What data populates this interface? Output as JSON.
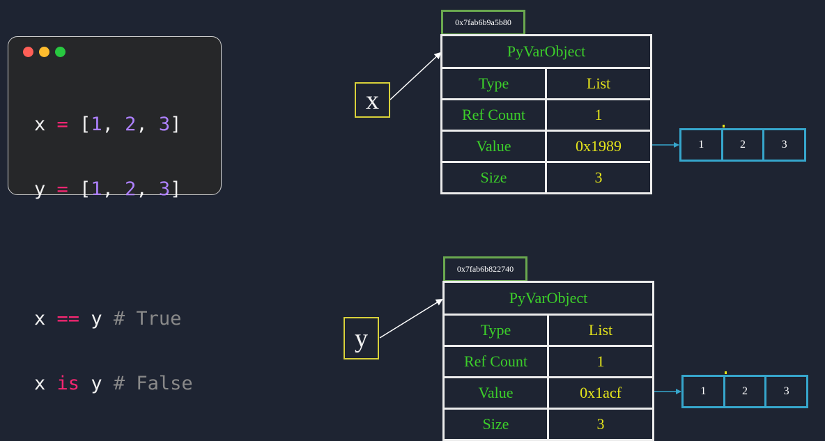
{
  "code_window": {
    "dot_colors": [
      "#ff5f57",
      "#febc2e",
      "#28c840"
    ],
    "lines": [
      {
        "var": "x",
        "op": "=",
        "open": "[",
        "n1": "1",
        "c1": ", ",
        "n2": "2",
        "c2": ", ",
        "n3": "3",
        "close": "]"
      },
      {
        "var": "y",
        "op": "=",
        "open": "[",
        "n1": "1",
        "c1": ", ",
        "n2": "2",
        "c2": ", ",
        "n3": "3",
        "close": "]"
      }
    ],
    "compare_lines": [
      {
        "left": "x",
        "op": "==",
        "right": "y",
        "comment": "# True"
      },
      {
        "left": "x",
        "op": "is",
        "right": "y",
        "comment": "# False"
      }
    ]
  },
  "objects": [
    {
      "var_name": "x",
      "address": "0x7fab6b9a5b80",
      "header": "PyVarObject",
      "rows": [
        {
          "key": "Type",
          "value": "List"
        },
        {
          "key": "Ref Count",
          "value": "1"
        },
        {
          "key": "Value",
          "value": "0x1989"
        },
        {
          "key": "Size",
          "value": "3"
        }
      ],
      "array": [
        "1",
        "2",
        "3"
      ]
    },
    {
      "var_name": "y",
      "address": "0x7fab6b822740",
      "header": "PyVarObject",
      "rows": [
        {
          "key": "Type",
          "value": "List"
        },
        {
          "key": "Ref Count",
          "value": "1"
        },
        {
          "key": "Value",
          "value": "0x1acf"
        },
        {
          "key": "Size",
          "value": "3"
        }
      ],
      "array": [
        "1",
        "2",
        "3"
      ]
    }
  ],
  "colors": {
    "background": "#1e2432",
    "variable_border": "#d8d13a",
    "address_border": "#6aa84f",
    "field_text": "#3ccf2a",
    "value_text": "#e5e51b",
    "array_border": "#36a6cc"
  }
}
